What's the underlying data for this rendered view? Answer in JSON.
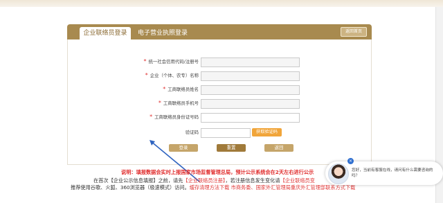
{
  "tabs": {
    "active": "企业联络员登录",
    "other": "电子营业执照登录",
    "back_home": "返回首页"
  },
  "form": {
    "fields": [
      {
        "label": "统一社会信用代码/注册号",
        "required": true
      },
      {
        "label": "企业（个体、农专）名称",
        "required": true
      },
      {
        "label": "工商联络员姓名",
        "required": true
      },
      {
        "label": "工商联络员手机号",
        "required": true
      },
      {
        "label": "工商联络员身份证号码",
        "required": true
      },
      {
        "label": "验证码",
        "required": false
      }
    ],
    "required_mark": "*",
    "get_code": "获取验证码",
    "buttons": {
      "login": "登录",
      "reset": "重置",
      "back": "返回"
    }
  },
  "notice": {
    "line1": "说明：填报数据会实时上报国家市场监督管理总局，预计公示系统会在2天左右进行公示",
    "line2_a": "在首次【企业公示信息填报】之前，请先",
    "line2_link": "【企业联络员注册】",
    "line2_b": "，若注册信息发生变化请",
    "line2_link2": "【企业联络员变",
    "line3_a": "推荐使用谷歌、火狐、360浏览器（极速模式）访问。",
    "line3_link": "缓存清理方法下载",
    "line3_b": " 市商务委、国家外汇管理局重庆外汇管理部联系方式下载"
  },
  "chat": {
    "message": "您好，当前有客服在线，请问有什么需要咨询的吗？",
    "close": "×"
  },
  "colors": {
    "header": "#a88a4f",
    "tab_text": "#8b6b34",
    "get_code": "#f1a53a",
    "login": "#c5a56a",
    "reset": "#a07a3a",
    "back": "#c5a56a",
    "notice": "#e02b2b"
  }
}
